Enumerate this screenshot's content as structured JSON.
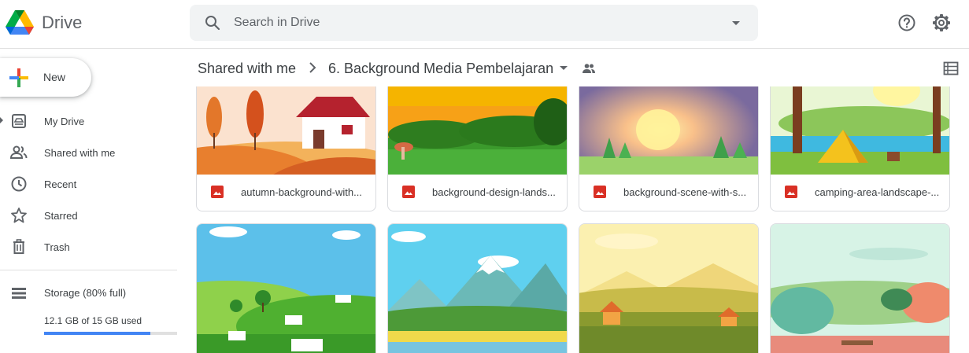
{
  "app": {
    "name": "Drive"
  },
  "search": {
    "placeholder": "Search in Drive",
    "value": ""
  },
  "sidebar": {
    "new_label": "New",
    "items": [
      {
        "label": "My Drive",
        "icon": "my-drive-icon"
      },
      {
        "label": "Shared with me",
        "icon": "shared-people-icon"
      },
      {
        "label": "Recent",
        "icon": "clock-icon"
      },
      {
        "label": "Starred",
        "icon": "star-icon"
      },
      {
        "label": "Trash",
        "icon": "trash-icon"
      }
    ],
    "storage": {
      "title": "Storage (80% full)",
      "used_text": "12.1 GB of 15 GB used",
      "used_fraction": 0.8
    }
  },
  "breadcrumb": {
    "root": "Shared with me",
    "current": "6. Background Media Pembelajaran"
  },
  "files": [
    {
      "name": "autumn-background-with-house.jpg",
      "display": "autumn-background-with..."
    },
    {
      "name": "background-design-landscape.jpg",
      "display": "background-design-lands..."
    },
    {
      "name": "background-scene-with-sunset.jpg",
      "display": "background-scene-with-s..."
    },
    {
      "name": "camping-area-landscape.jpg",
      "display": "camping-area-landscape-..."
    }
  ],
  "colors": {
    "accent": "#4285f4",
    "image_icon": "#d93025",
    "search_bg": "#f1f3f4"
  }
}
